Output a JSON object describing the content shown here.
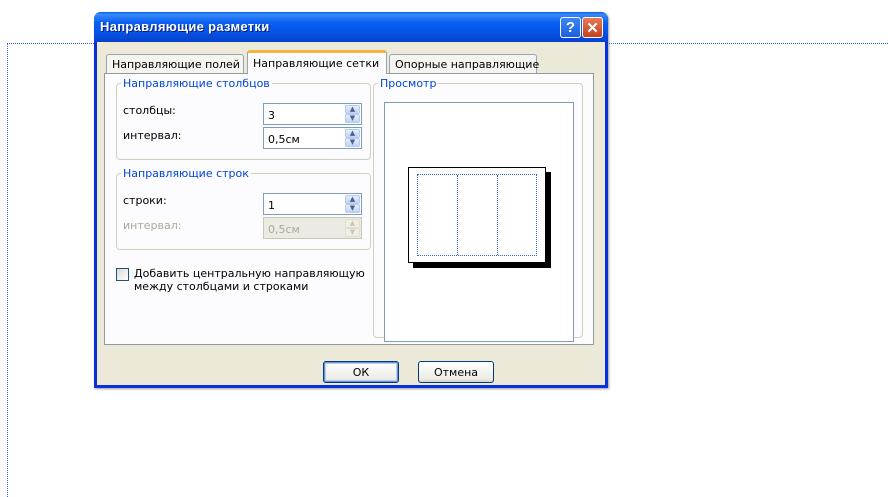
{
  "dialog": {
    "title": "Направляющие разметки",
    "help_glyph": "?",
    "close_glyph": "✕"
  },
  "tabs": [
    {
      "label": "Направляющие полей",
      "active": false
    },
    {
      "label": "Направляющие сетки",
      "active": true
    },
    {
      "label": "Опорные направляющие",
      "active": false
    }
  ],
  "columns_group": {
    "legend": "Направляющие столбцов",
    "count_label": "столбцы:",
    "count_value": "3",
    "spacing_label": "интервал:",
    "spacing_value": "0,5см"
  },
  "rows_group": {
    "legend": "Направляющие строк",
    "count_label": "строки:",
    "count_value": "1",
    "spacing_label": "интервал:",
    "spacing_value": "0,5см",
    "spacing_disabled": true
  },
  "center_guide": {
    "label": "Добавить центральную направляющую между столбцами и строками",
    "checked": false
  },
  "preview": {
    "legend": "Просмотр",
    "columns": 3,
    "rows": 1,
    "guide_color": "#2f67d8"
  },
  "buttons": {
    "ok": "ОК",
    "cancel": "Отмена"
  },
  "icons": {
    "up": "▲",
    "down": "▼"
  }
}
